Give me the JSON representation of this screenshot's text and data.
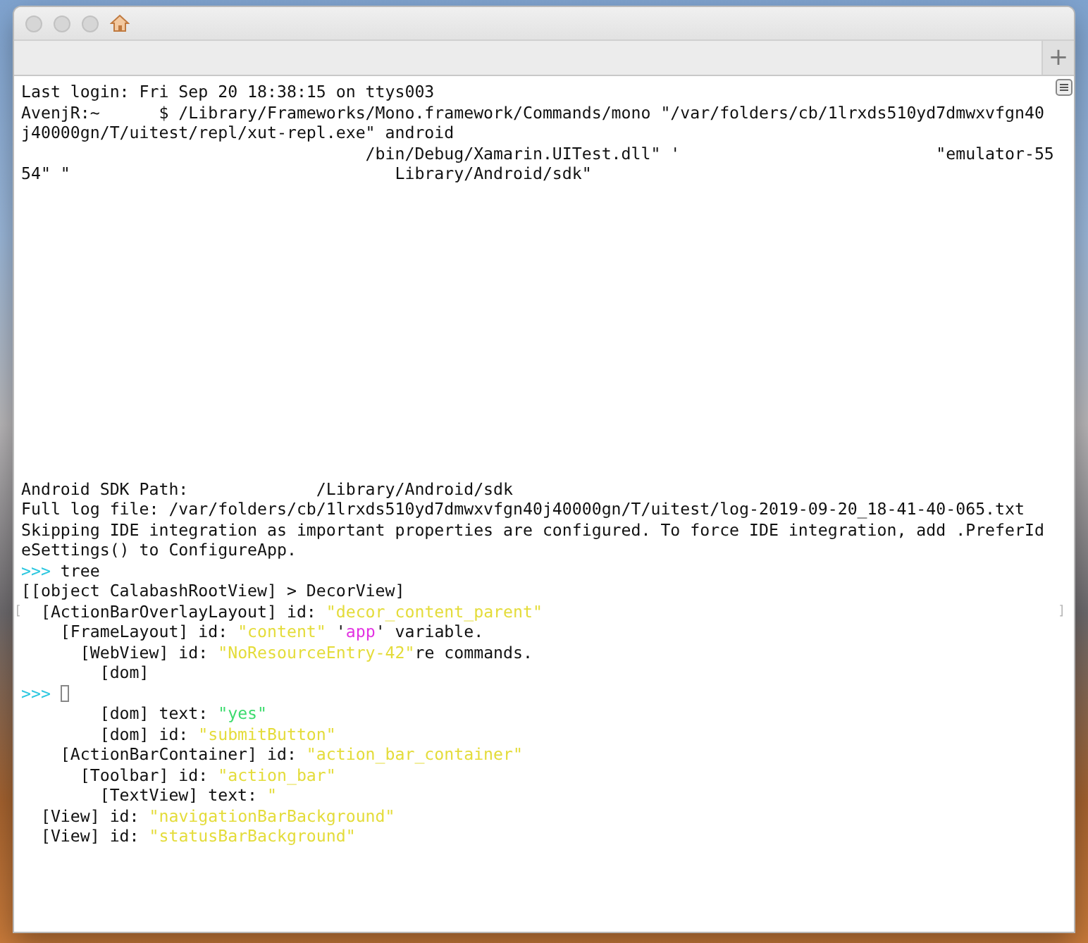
{
  "window": {
    "tab_bar": {
      "new_tab_button": "+"
    }
  },
  "terminal": {
    "header_lines": [
      {
        "segments": [
          {
            "kind": "plain",
            "text": "Last login: Fri Sep 20 18:38:15 on ttys003"
          }
        ]
      },
      {
        "segments": [
          {
            "kind": "plain",
            "text": "AvenjR:~      $ /Library/Frameworks/Mono.framework/Commands/mono \"/var/folders/cb/1lrxds510yd7dmwxvfgn40"
          }
        ]
      },
      {
        "segments": [
          {
            "kind": "plain",
            "text": "j40000gn/T/uitest/repl/xut-repl.exe\" android"
          }
        ]
      },
      {
        "segments": [
          {
            "kind": "plain",
            "text": "                                   /bin/Debug/Xamarin.UITest.dll\" '                          \"emulator-55"
          }
        ]
      },
      {
        "segments": [
          {
            "kind": "plain",
            "text": "54\" \"                                 Library/Android/sdk\""
          }
        ]
      }
    ],
    "lines": [
      {
        "segments": [
          {
            "kind": "plain",
            "text": "Android SDK Path:             /Library/Android/sdk"
          }
        ]
      },
      {
        "segments": [
          {
            "kind": "plain",
            "text": "Full log file: /var/folders/cb/1lrxds510yd7dmwxvfgn40j40000gn/T/uitest/log-2019-09-20_18-41-40-065.txt"
          }
        ]
      },
      {
        "segments": [
          {
            "kind": "plain",
            "text": "Skipping IDE integration as important properties are configured. To force IDE integration, add .PreferId"
          }
        ]
      },
      {
        "segments": [
          {
            "kind": "plain",
            "text": "eSettings() to ConfigureApp."
          }
        ]
      },
      {
        "segments": [
          {
            "kind": "prompt",
            "text": ">>>"
          },
          {
            "kind": "plain",
            "text": " tree"
          }
        ]
      },
      {
        "segments": [
          {
            "kind": "plain",
            "text": "[[object CalabashRootView] > DecorView]"
          }
        ]
      },
      {
        "mark_left": "[",
        "mark_right": "]",
        "segments": [
          {
            "kind": "plain",
            "text": "  [ActionBarOverlayLayout] id: "
          },
          {
            "kind": "string",
            "text": "\"decor_content_parent\""
          }
        ]
      },
      {
        "segments": [
          {
            "kind": "plain",
            "text": "    [FrameLayout] id: "
          },
          {
            "kind": "string",
            "text": "\"content\""
          },
          {
            "kind": "plain",
            "text": " '"
          },
          {
            "kind": "variable",
            "text": "app"
          },
          {
            "kind": "plain",
            "text": "' variable."
          }
        ]
      },
      {
        "segments": [
          {
            "kind": "plain",
            "text": "      [WebView] id: "
          },
          {
            "kind": "string",
            "text": "\"NoResourceEntry-42\""
          },
          {
            "kind": "plain",
            "text": "re commands."
          }
        ]
      },
      {
        "segments": [
          {
            "kind": "plain",
            "text": "        [dom]"
          }
        ]
      },
      {
        "cursor": true,
        "segments": [
          {
            "kind": "prompt",
            "text": ">>>"
          }
        ]
      },
      {
        "segments": [
          {
            "kind": "plain",
            "text": "        [dom] text: "
          },
          {
            "kind": "success",
            "text": "\"yes\""
          }
        ]
      },
      {
        "segments": [
          {
            "kind": "plain",
            "text": "        [dom] id: "
          },
          {
            "kind": "string",
            "text": "\"submitButton\""
          }
        ]
      },
      {
        "segments": [
          {
            "kind": "plain",
            "text": "    [ActionBarContainer] id: "
          },
          {
            "kind": "string",
            "text": "\"action_bar_container\""
          }
        ]
      },
      {
        "segments": [
          {
            "kind": "plain",
            "text": "      [Toolbar] id: "
          },
          {
            "kind": "string",
            "text": "\"action_bar\""
          }
        ]
      },
      {
        "segments": [
          {
            "kind": "plain",
            "text": "        [TextView] text: "
          },
          {
            "kind": "string",
            "text": "\""
          }
        ]
      },
      {
        "segments": [
          {
            "kind": "plain",
            "text": "  [View] id: "
          },
          {
            "kind": "string",
            "text": "\"navigationBarBackground\""
          }
        ]
      },
      {
        "segments": [
          {
            "kind": "plain",
            "text": "  [View] id: "
          },
          {
            "kind": "string",
            "text": "\"statusBarBackground\""
          }
        ]
      }
    ]
  }
}
